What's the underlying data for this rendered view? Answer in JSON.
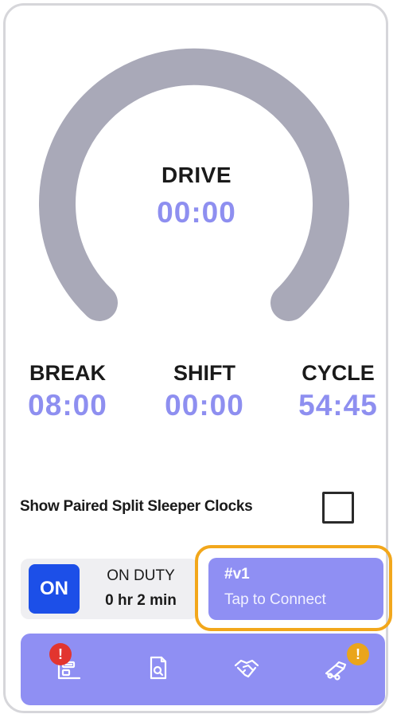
{
  "gauge": {
    "label": "DRIVE",
    "value": "00:00"
  },
  "clocks": {
    "break": {
      "label": "BREAK",
      "value": "08:00"
    },
    "shift": {
      "label": "SHIFT",
      "value": "00:00"
    },
    "cycle": {
      "label": "CYCLE",
      "value": "54:45"
    }
  },
  "split_sleeper": {
    "label": "Show Paired Split Sleeper Clocks",
    "checked": false
  },
  "duty": {
    "badge": "ON",
    "status": "ON DUTY",
    "time": "0 hr 2 min"
  },
  "connect": {
    "device_id": "#v1",
    "action": "Tap to Connect"
  },
  "toolbar": {
    "items": [
      {
        "icon": "logs-icon",
        "alert": "!"
      },
      {
        "icon": "document-search-icon"
      },
      {
        "icon": "handshake-icon"
      },
      {
        "icon": "truck-icon",
        "alert": "!"
      }
    ]
  },
  "colors": {
    "accent": "#8e8ff0",
    "toolbar_bg": "#8f8ff3",
    "on_badge": "#1c4fe8",
    "gauge_track": "#a9a9b8",
    "highlight": "#f2a71b",
    "alert_red": "#e2352f",
    "alert_yellow": "#eaa51c"
  }
}
